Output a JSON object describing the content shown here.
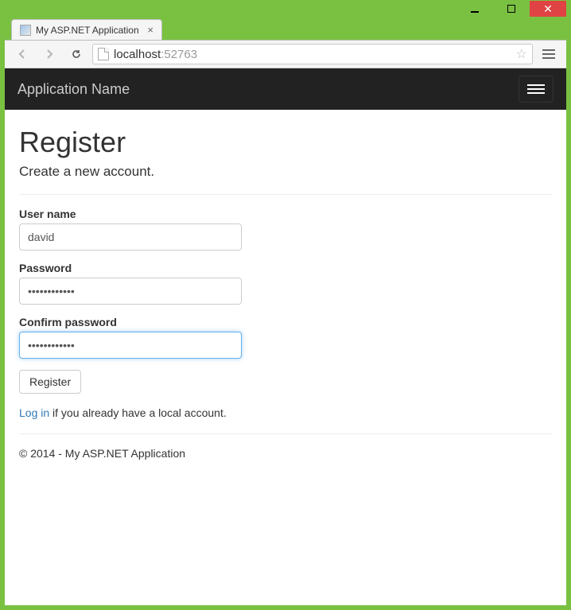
{
  "browser": {
    "tab_title": "My ASP.NET Application",
    "url_host": "localhost",
    "url_port": ":52763"
  },
  "navbar": {
    "brand": "Application Name"
  },
  "page": {
    "heading": "Register",
    "subtitle": "Create a new account."
  },
  "form": {
    "username_label": "User name",
    "username_value": "david",
    "password_label": "Password",
    "password_value": "••••••••••••",
    "confirm_label": "Confirm password",
    "confirm_value": "••••••••••••",
    "submit_label": "Register"
  },
  "login_hint": {
    "link_text": "Log in",
    "rest": " if you already have a local account."
  },
  "footer": {
    "text": "© 2014 - My ASP.NET Application"
  }
}
